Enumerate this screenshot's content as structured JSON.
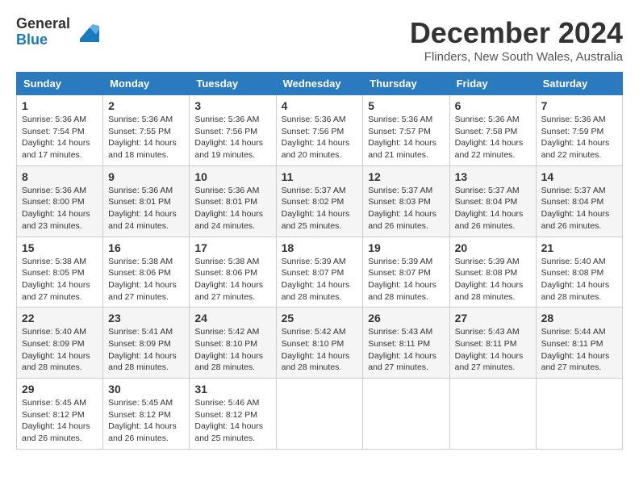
{
  "header": {
    "logo_general": "General",
    "logo_blue": "Blue",
    "title": "December 2024",
    "location": "Flinders, New South Wales, Australia"
  },
  "calendar": {
    "days_of_week": [
      "Sunday",
      "Monday",
      "Tuesday",
      "Wednesday",
      "Thursday",
      "Friday",
      "Saturday"
    ],
    "weeks": [
      [
        {
          "day": "1",
          "sunrise": "5:36 AM",
          "sunset": "7:54 PM",
          "daylight": "14 hours and 17 minutes."
        },
        {
          "day": "2",
          "sunrise": "5:36 AM",
          "sunset": "7:55 PM",
          "daylight": "14 hours and 18 minutes."
        },
        {
          "day": "3",
          "sunrise": "5:36 AM",
          "sunset": "7:56 PM",
          "daylight": "14 hours and 19 minutes."
        },
        {
          "day": "4",
          "sunrise": "5:36 AM",
          "sunset": "7:56 PM",
          "daylight": "14 hours and 20 minutes."
        },
        {
          "day": "5",
          "sunrise": "5:36 AM",
          "sunset": "7:57 PM",
          "daylight": "14 hours and 21 minutes."
        },
        {
          "day": "6",
          "sunrise": "5:36 AM",
          "sunset": "7:58 PM",
          "daylight": "14 hours and 22 minutes."
        },
        {
          "day": "7",
          "sunrise": "5:36 AM",
          "sunset": "7:59 PM",
          "daylight": "14 hours and 22 minutes."
        }
      ],
      [
        {
          "day": "8",
          "sunrise": "5:36 AM",
          "sunset": "8:00 PM",
          "daylight": "14 hours and 23 minutes."
        },
        {
          "day": "9",
          "sunrise": "5:36 AM",
          "sunset": "8:01 PM",
          "daylight": "14 hours and 24 minutes."
        },
        {
          "day": "10",
          "sunrise": "5:36 AM",
          "sunset": "8:01 PM",
          "daylight": "14 hours and 24 minutes."
        },
        {
          "day": "11",
          "sunrise": "5:37 AM",
          "sunset": "8:02 PM",
          "daylight": "14 hours and 25 minutes."
        },
        {
          "day": "12",
          "sunrise": "5:37 AM",
          "sunset": "8:03 PM",
          "daylight": "14 hours and 26 minutes."
        },
        {
          "day": "13",
          "sunrise": "5:37 AM",
          "sunset": "8:04 PM",
          "daylight": "14 hours and 26 minutes."
        },
        {
          "day": "14",
          "sunrise": "5:37 AM",
          "sunset": "8:04 PM",
          "daylight": "14 hours and 26 minutes."
        }
      ],
      [
        {
          "day": "15",
          "sunrise": "5:38 AM",
          "sunset": "8:05 PM",
          "daylight": "14 hours and 27 minutes."
        },
        {
          "day": "16",
          "sunrise": "5:38 AM",
          "sunset": "8:06 PM",
          "daylight": "14 hours and 27 minutes."
        },
        {
          "day": "17",
          "sunrise": "5:38 AM",
          "sunset": "8:06 PM",
          "daylight": "14 hours and 27 minutes."
        },
        {
          "day": "18",
          "sunrise": "5:39 AM",
          "sunset": "8:07 PM",
          "daylight": "14 hours and 28 minutes."
        },
        {
          "day": "19",
          "sunrise": "5:39 AM",
          "sunset": "8:07 PM",
          "daylight": "14 hours and 28 minutes."
        },
        {
          "day": "20",
          "sunrise": "5:39 AM",
          "sunset": "8:08 PM",
          "daylight": "14 hours and 28 minutes."
        },
        {
          "day": "21",
          "sunrise": "5:40 AM",
          "sunset": "8:08 PM",
          "daylight": "14 hours and 28 minutes."
        }
      ],
      [
        {
          "day": "22",
          "sunrise": "5:40 AM",
          "sunset": "8:09 PM",
          "daylight": "14 hours and 28 minutes."
        },
        {
          "day": "23",
          "sunrise": "5:41 AM",
          "sunset": "8:09 PM",
          "daylight": "14 hours and 28 minutes."
        },
        {
          "day": "24",
          "sunrise": "5:42 AM",
          "sunset": "8:10 PM",
          "daylight": "14 hours and 28 minutes."
        },
        {
          "day": "25",
          "sunrise": "5:42 AM",
          "sunset": "8:10 PM",
          "daylight": "14 hours and 28 minutes."
        },
        {
          "day": "26",
          "sunrise": "5:43 AM",
          "sunset": "8:11 PM",
          "daylight": "14 hours and 27 minutes."
        },
        {
          "day": "27",
          "sunrise": "5:43 AM",
          "sunset": "8:11 PM",
          "daylight": "14 hours and 27 minutes."
        },
        {
          "day": "28",
          "sunrise": "5:44 AM",
          "sunset": "8:11 PM",
          "daylight": "14 hours and 27 minutes."
        }
      ],
      [
        {
          "day": "29",
          "sunrise": "5:45 AM",
          "sunset": "8:12 PM",
          "daylight": "14 hours and 26 minutes."
        },
        {
          "day": "30",
          "sunrise": "5:45 AM",
          "sunset": "8:12 PM",
          "daylight": "14 hours and 26 minutes."
        },
        {
          "day": "31",
          "sunrise": "5:46 AM",
          "sunset": "8:12 PM",
          "daylight": "14 hours and 25 minutes."
        },
        null,
        null,
        null,
        null
      ]
    ]
  }
}
